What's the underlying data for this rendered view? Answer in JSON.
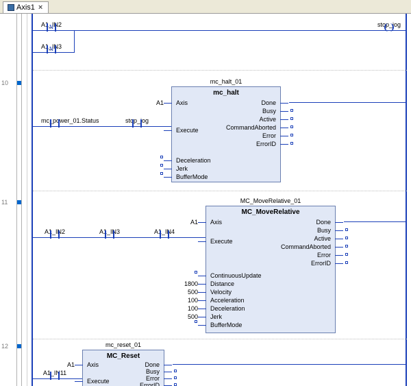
{
  "tab": {
    "title": "Axis1",
    "close": "×"
  },
  "rungs": {
    "r10": "10",
    "r11": "11",
    "r12": "12"
  },
  "rung9": {
    "c1": "A1_IN2",
    "c1_inner": "N",
    "c2": "A1_IN3",
    "c2_inner": "N",
    "coil": "stop_jog"
  },
  "rung10": {
    "c1": "mc_power_01.Status",
    "c2": "stop_jog",
    "fb_inst": "mc_halt_01",
    "fb_type": "mc_halt",
    "axis_val": "A1",
    "ports_left": [
      "Axis",
      "Execute",
      "Deceleration",
      "Jerk",
      "BufferMode"
    ],
    "ports_right": [
      "Done",
      "Busy",
      "Active",
      "CommandAborted",
      "Error",
      "ErrorID"
    ]
  },
  "rung11": {
    "c1": "A1_IN2",
    "c2": "A1_IN3",
    "c3": "A1_IN4",
    "fb_inst": "MC_MoveRelative_01",
    "fb_type": "MC_MoveRelative",
    "axis_val": "A1",
    "left_labels": [
      "Axis",
      "Execute",
      "ContinuousUpdate",
      "Distance",
      "Velocity",
      "Acceleration",
      "Deceleration",
      "Jerk",
      "BufferMode"
    ],
    "left_vals": [
      "",
      "",
      "",
      "1800",
      "500",
      "100",
      "100",
      "500",
      ""
    ],
    "ports_right": [
      "Done",
      "Busy",
      "Active",
      "CommandAborted",
      "Error",
      "ErrorID"
    ]
  },
  "rung12": {
    "c1": "A1_IN11",
    "fb_inst": "mc_reset_01",
    "fb_type": "MC_Reset",
    "axis_val": "A1",
    "ports_left": [
      "Axis",
      "Execute"
    ],
    "ports_right": [
      "Done",
      "Busy",
      "Error",
      "ErrorID"
    ]
  }
}
